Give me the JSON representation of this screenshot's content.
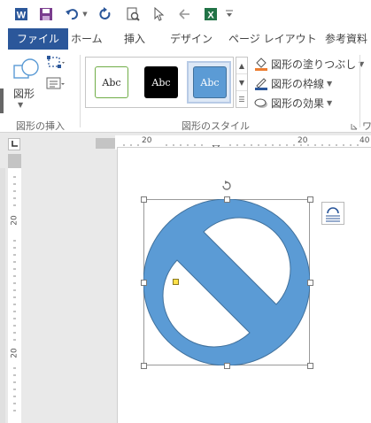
{
  "qat": {
    "icons": [
      "word-icon",
      "save-icon",
      "undo-icon",
      "redo-icon",
      "print-preview-icon",
      "pointer-icon",
      "back-icon",
      "excel-icon",
      "customize-icon"
    ]
  },
  "tabs": [
    {
      "label": "ファイル",
      "active": true
    },
    {
      "label": "ホーム"
    },
    {
      "label": "挿入"
    },
    {
      "label": "デザイン"
    },
    {
      "label": "ページ レイアウト"
    },
    {
      "label": "参考資料"
    }
  ],
  "ribbon": {
    "insert_group": {
      "shapes_label": "図形",
      "group_label": "図形の挿入"
    },
    "style_group": {
      "swatches": [
        "Abc",
        "Abc",
        "Abc"
      ],
      "fill_label": "図形の塗りつぶし",
      "outline_label": "図形の枠線",
      "effects_label": "図形の効果",
      "group_label": "図形のスタイル",
      "next_group_label": "ワ"
    }
  },
  "ruler": {
    "h_labels": [
      "20",
      "20",
      "40"
    ],
    "v_labels": [
      "20",
      "20"
    ]
  },
  "shape": {
    "type": "no-symbol",
    "fill_color": "#5b9bd5",
    "border_color": "#41719c"
  },
  "colors": {
    "file_tab": "#2b579a",
    "swatch_outline": "#70ad47",
    "swatch_dark": "#000000",
    "swatch_blue": "#5b9bd5",
    "word_blue": "#2b579a",
    "excel_green": "#217346",
    "save_purple": "#7a3d8e"
  }
}
